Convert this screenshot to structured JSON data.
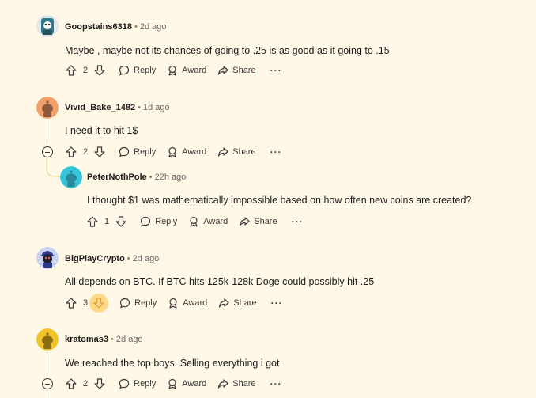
{
  "actions": {
    "reply_label": "Reply",
    "award_label": "Award",
    "share_label": "Share",
    "more_label": "···"
  },
  "comments": [
    {
      "author": "Goopstains6318",
      "separator": "•",
      "time": "2d ago",
      "text": "Maybe , maybe not its chances of going to .25 is as good as it going to .15",
      "votes": "2",
      "avatar_color": "#2f7b8a"
    },
    {
      "author": "Vivid_Bake_1482",
      "separator": "•",
      "time": "1d ago",
      "text": "I need it to hit 1$",
      "votes": "2",
      "avatar_color": "#f4a06b"
    },
    {
      "author": "PeterNothPole",
      "separator": "•",
      "time": "22h ago",
      "text": "I thought $1 was mathematically impossible based on how often new coins are created?",
      "votes": "1",
      "avatar_color": "#35c7d9"
    },
    {
      "author": "BigPlayCrypto",
      "separator": "•",
      "time": "2d ago",
      "text": "All depends on BTC. If BTC hits 125k-128k Doge could possibly hit .25",
      "votes": "3",
      "avatar_color": "#2c3a8c"
    },
    {
      "author": "kratomas3",
      "separator": "•",
      "time": "2d ago",
      "text": "We reached the top boys. Selling everything i got",
      "votes": "2",
      "avatar_color": "#f2c22b"
    }
  ],
  "colors": {
    "background": "#fff8e6",
    "thread_line": "#f0d98a",
    "downvote_highlight": "#ffd98a"
  }
}
